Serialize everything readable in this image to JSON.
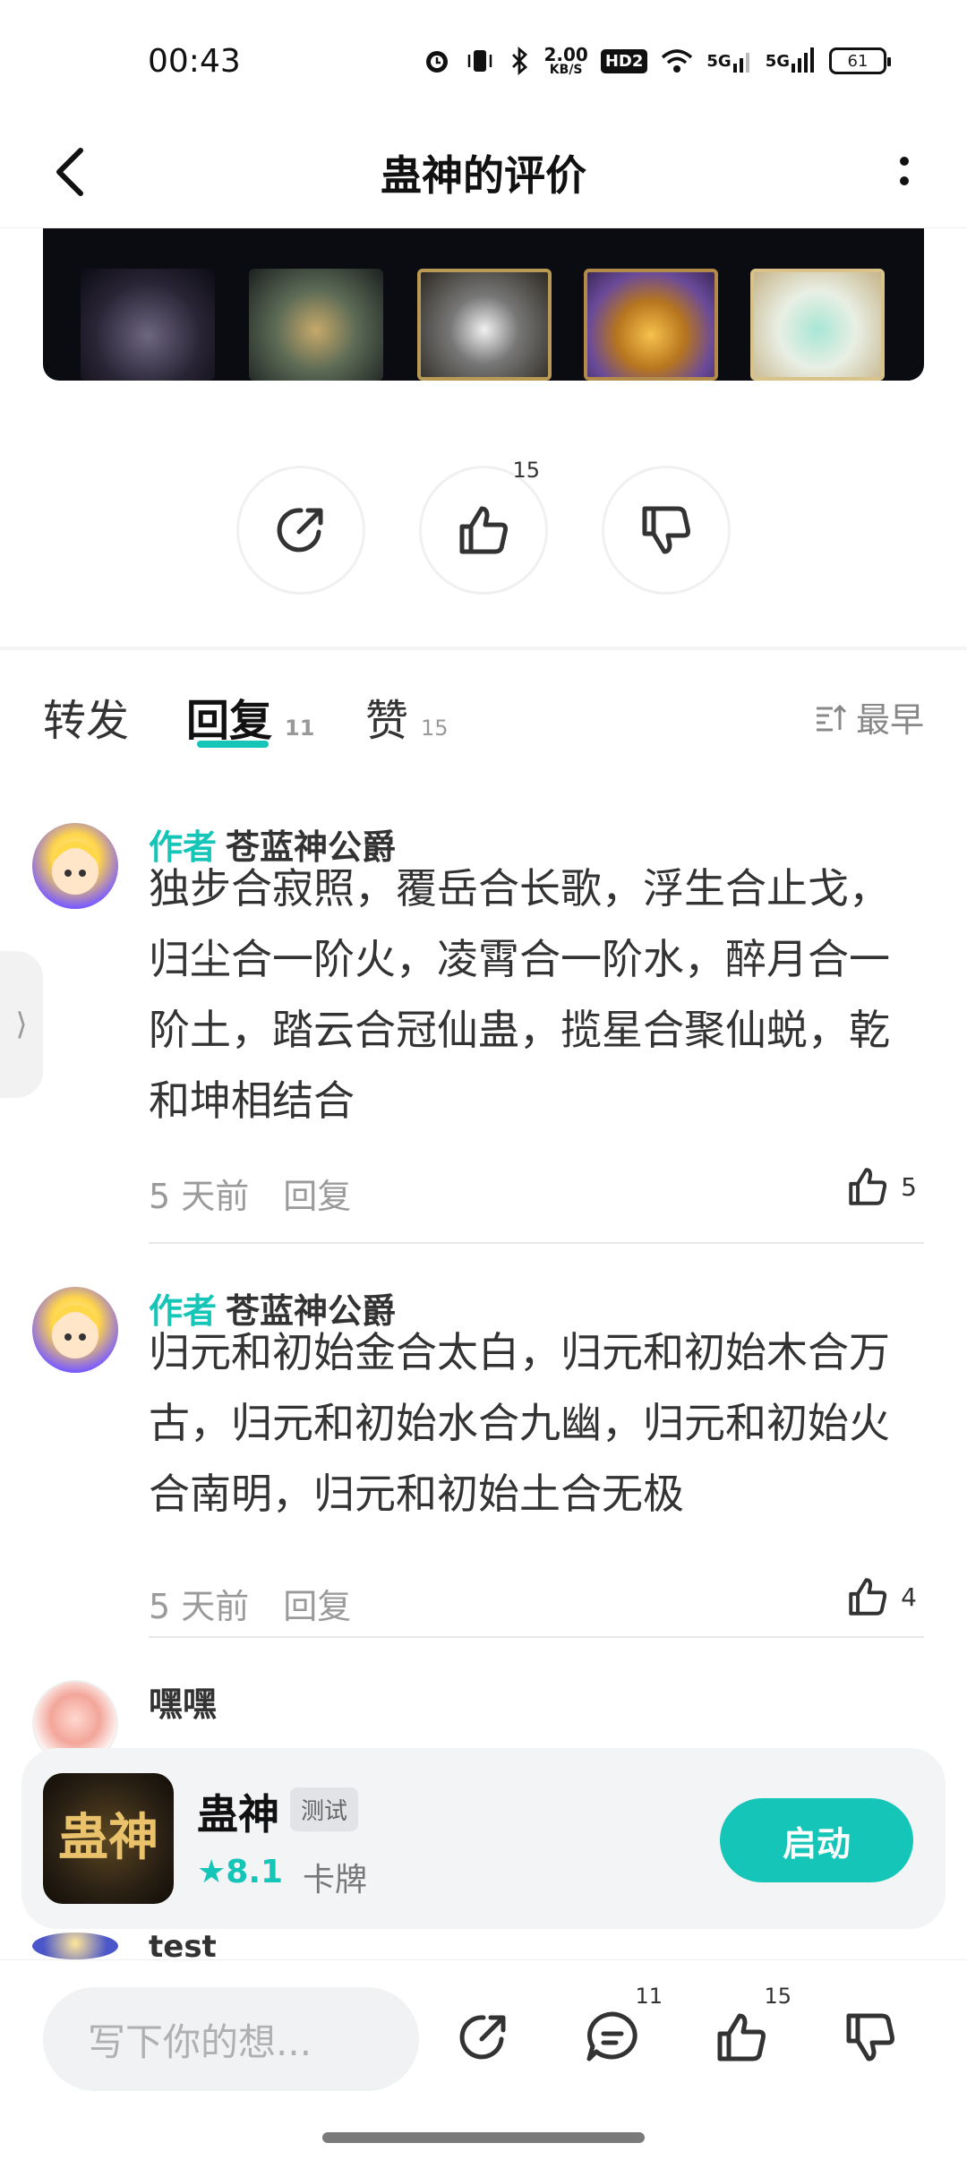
{
  "status_bar": {
    "time": "00:43",
    "speed_value": "2.00",
    "speed_unit": "KB/S",
    "hd_tag": "HD2",
    "net1": "5G",
    "net2": "5G",
    "battery": "61"
  },
  "header": {
    "title": "蛊神的评价"
  },
  "actions": {
    "like_count": "15"
  },
  "tabs": {
    "forward": "转发",
    "reply": "回复",
    "reply_count": "11",
    "likes": "赞",
    "likes_count": "15",
    "sort_label": "最早"
  },
  "comments": [
    {
      "author_tag": "作者",
      "name": "苍蓝神公爵",
      "text": "独步合寂照，覆岳合长歌，浮生合止戈，归尘合一阶火，凌霄合一阶水，醉月合一阶土，踏云合冠仙蛊，揽星合聚仙蜕，乾和坤相结合",
      "time": "5 天前",
      "reply_label": "回复",
      "likes": "5"
    },
    {
      "author_tag": "作者",
      "name": "苍蓝神公爵",
      "text": "归元和初始金合太白，归元和初始木合万古，归元和初始水合九幽，归元和初始火合南明，归元和初始土合无极",
      "time": "5 天前",
      "reply_label": "回复",
      "likes": "4"
    },
    {
      "name": "嘿嘿"
    },
    {
      "name": "test"
    }
  ],
  "game_card": {
    "icon_text": "蛊神",
    "name": "蛊神",
    "tag": "测试",
    "rating": "★8.1",
    "type": "卡牌",
    "launch_label": "启动"
  },
  "bottom_bar": {
    "input_placeholder": "写下你的想...",
    "comment_count": "11",
    "like_count": "15"
  },
  "colors": {
    "accent": "#15c5b8"
  }
}
